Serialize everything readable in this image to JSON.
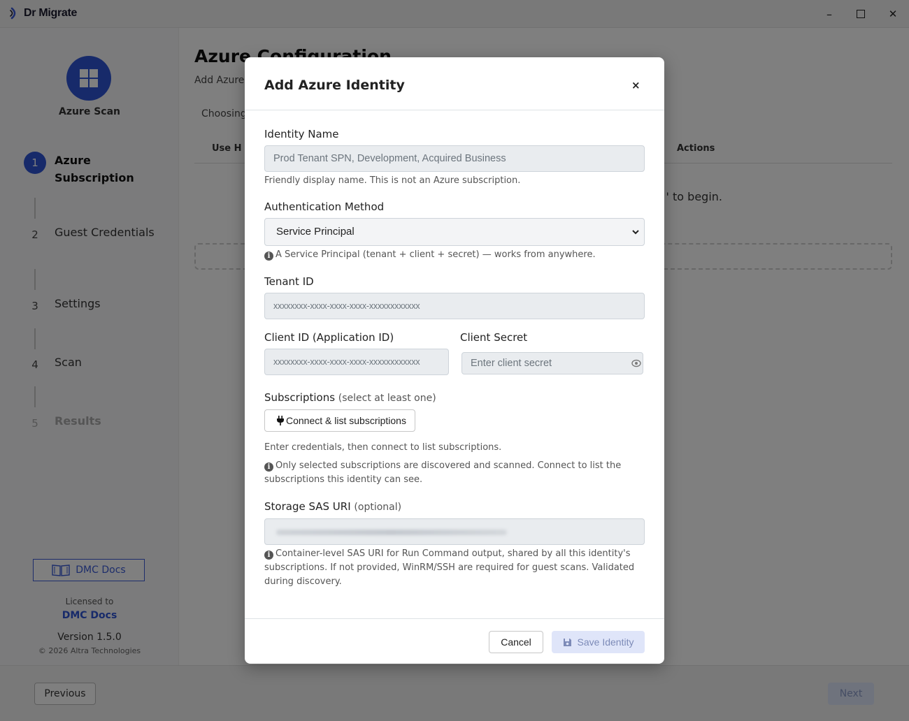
{
  "app": {
    "title": "Dr Migrate"
  },
  "sidebar": {
    "scan_label": "Azure Scan",
    "steps": [
      {
        "num": "1",
        "label": "Azure Subscription"
      },
      {
        "num": "2",
        "label": "Guest Credentials"
      },
      {
        "num": "3",
        "label": "Settings"
      },
      {
        "num": "4",
        "label": "Scan"
      },
      {
        "num": "5",
        "label": "Results"
      }
    ],
    "docs_button": "DMC Docs",
    "licensed_to_label": "Licensed to",
    "licensee": "DMC Docs",
    "version": "Version 1.5.0",
    "copyright": "© 2026 Altra Technologies"
  },
  "main": {
    "title": "Azure Configuration",
    "description": "Add Azure                                                                                                              cover its accessible subscriptions and VMs, then selec",
    "description2": "Choosing                                                                                                               an types.",
    "table_header_use": "Use  H",
    "table_header_actions": "Actions",
    "empty_message": "' to begin."
  },
  "modal": {
    "title": "Add Azure Identity",
    "close": "×",
    "identity_name": {
      "label": "Identity Name",
      "placeholder": "Prod Tenant SPN, Development, Acquired Business",
      "hint": "Friendly display name. This is not an Azure subscription."
    },
    "auth_method": {
      "label": "Authentication Method",
      "selected": "Service Principal",
      "hint": "A Service Principal (tenant + client + secret) — works from anywhere."
    },
    "tenant_id": {
      "label": "Tenant ID",
      "placeholder": "xxxxxxxx-xxxx-xxxx-xxxx-xxxxxxxxxxxx"
    },
    "client_id": {
      "label": "Client ID (Application ID)",
      "placeholder": "xxxxxxxx-xxxx-xxxx-xxxx-xxxxxxxxxxxx"
    },
    "client_secret": {
      "label": "Client Secret",
      "placeholder": "Enter client secret"
    },
    "subscriptions": {
      "label": "Subscriptions",
      "label_note": "(select at least one)",
      "connect_button": "Connect & list subscriptions",
      "hint": "Enter credentials, then connect to list subscriptions.",
      "info": "Only selected subscriptions are discovered and scanned. Connect to list the subscriptions this identity can see."
    },
    "storage_sas": {
      "label": "Storage SAS URI",
      "label_note": "(optional)",
      "info": "Container-level SAS URI for Run Command output, shared by all this identity's subscriptions. If not provided, WinRM/SSH are required for guest scans. Validated during discovery."
    },
    "cancel_button": "Cancel",
    "save_button": "Save Identity"
  },
  "footer": {
    "previous_button": "Previous",
    "next_button": "Next"
  },
  "colors": {
    "accent": "#2f55d4",
    "disabled_button_bg": "#dfe5f9"
  }
}
